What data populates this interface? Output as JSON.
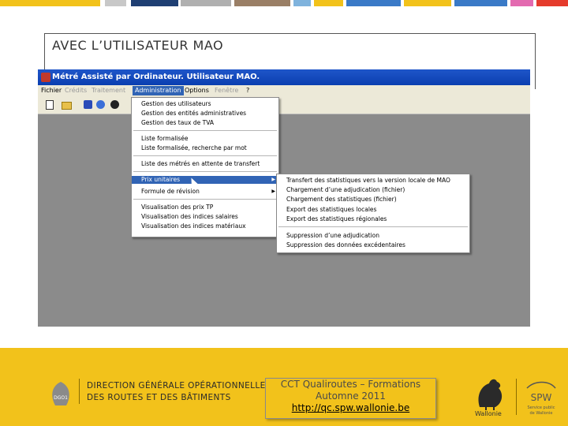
{
  "slide": {
    "title": "AVEC L’UTILISATEUR MAO",
    "top_strip_colors": [
      "#f2c21b",
      "#c8c8c8",
      "#2e8b3a",
      "#3a7ac7",
      "#1f3f73",
      "#b0b0b0",
      "#9a7f66",
      "#7fb3dd",
      "#f2c21b",
      "#3a7ac7",
      "#c8c8c8",
      "#f2c21b",
      "#3a7ac7",
      "#e36ab0",
      "#e53b2c"
    ]
  },
  "app": {
    "window_title": "Métré Assisté par Ordinateur. Utilisateur MAO.",
    "menubar": {
      "items": [
        "Fichier",
        "Crédits",
        "Traitement",
        "Administration",
        "Options",
        "Fenêtre",
        "?"
      ]
    },
    "toolbar_icons": [
      "new-document-icon",
      "open-folder-icon",
      "save-icon",
      "refresh-icon",
      "globe-icon"
    ],
    "admin_menu": {
      "items": [
        "Gestion des utilisateurs",
        "Gestion des entités administratives",
        "Gestion des taux de TVA",
        "Liste formalisée",
        "Liste formalisée, recherche par mot",
        "Liste des métrés en attente de transfert",
        "Prix unitaires",
        "Formule de révision",
        "Visualisation des prix TP",
        "Visualisation des indices salaires",
        "Visualisation des indices matériaux"
      ]
    },
    "prix_submenu": {
      "items": [
        "Transfert des statistiques vers la version locale de MAO",
        "Chargement d’une adjudication (fichier)",
        "Chargement des statistiques (fichier)",
        "Export des statistiques locales",
        "Export des statistiques régionales",
        "Suppression d’une adjudication",
        "Suppression des données excédentaires"
      ]
    }
  },
  "footer": {
    "logo_label": "DGO1",
    "org_line1": "DIRECTION GÉNÉRALE OPÉRATIONNELLE",
    "org_line2": "DES ROUTES ET DES BÂTIMENTS",
    "cct_line1": "CCT Qualiroutes – Formations",
    "cct_line2": "Automne 2011",
    "cct_url": "http://qc.spw.wallonie.be",
    "wallonie_label": "Wallonie",
    "spw_label": "SPW",
    "spw_sub1": "Service public",
    "spw_sub2": "de Wallonie",
    "footer_color": "#f2c21b"
  }
}
